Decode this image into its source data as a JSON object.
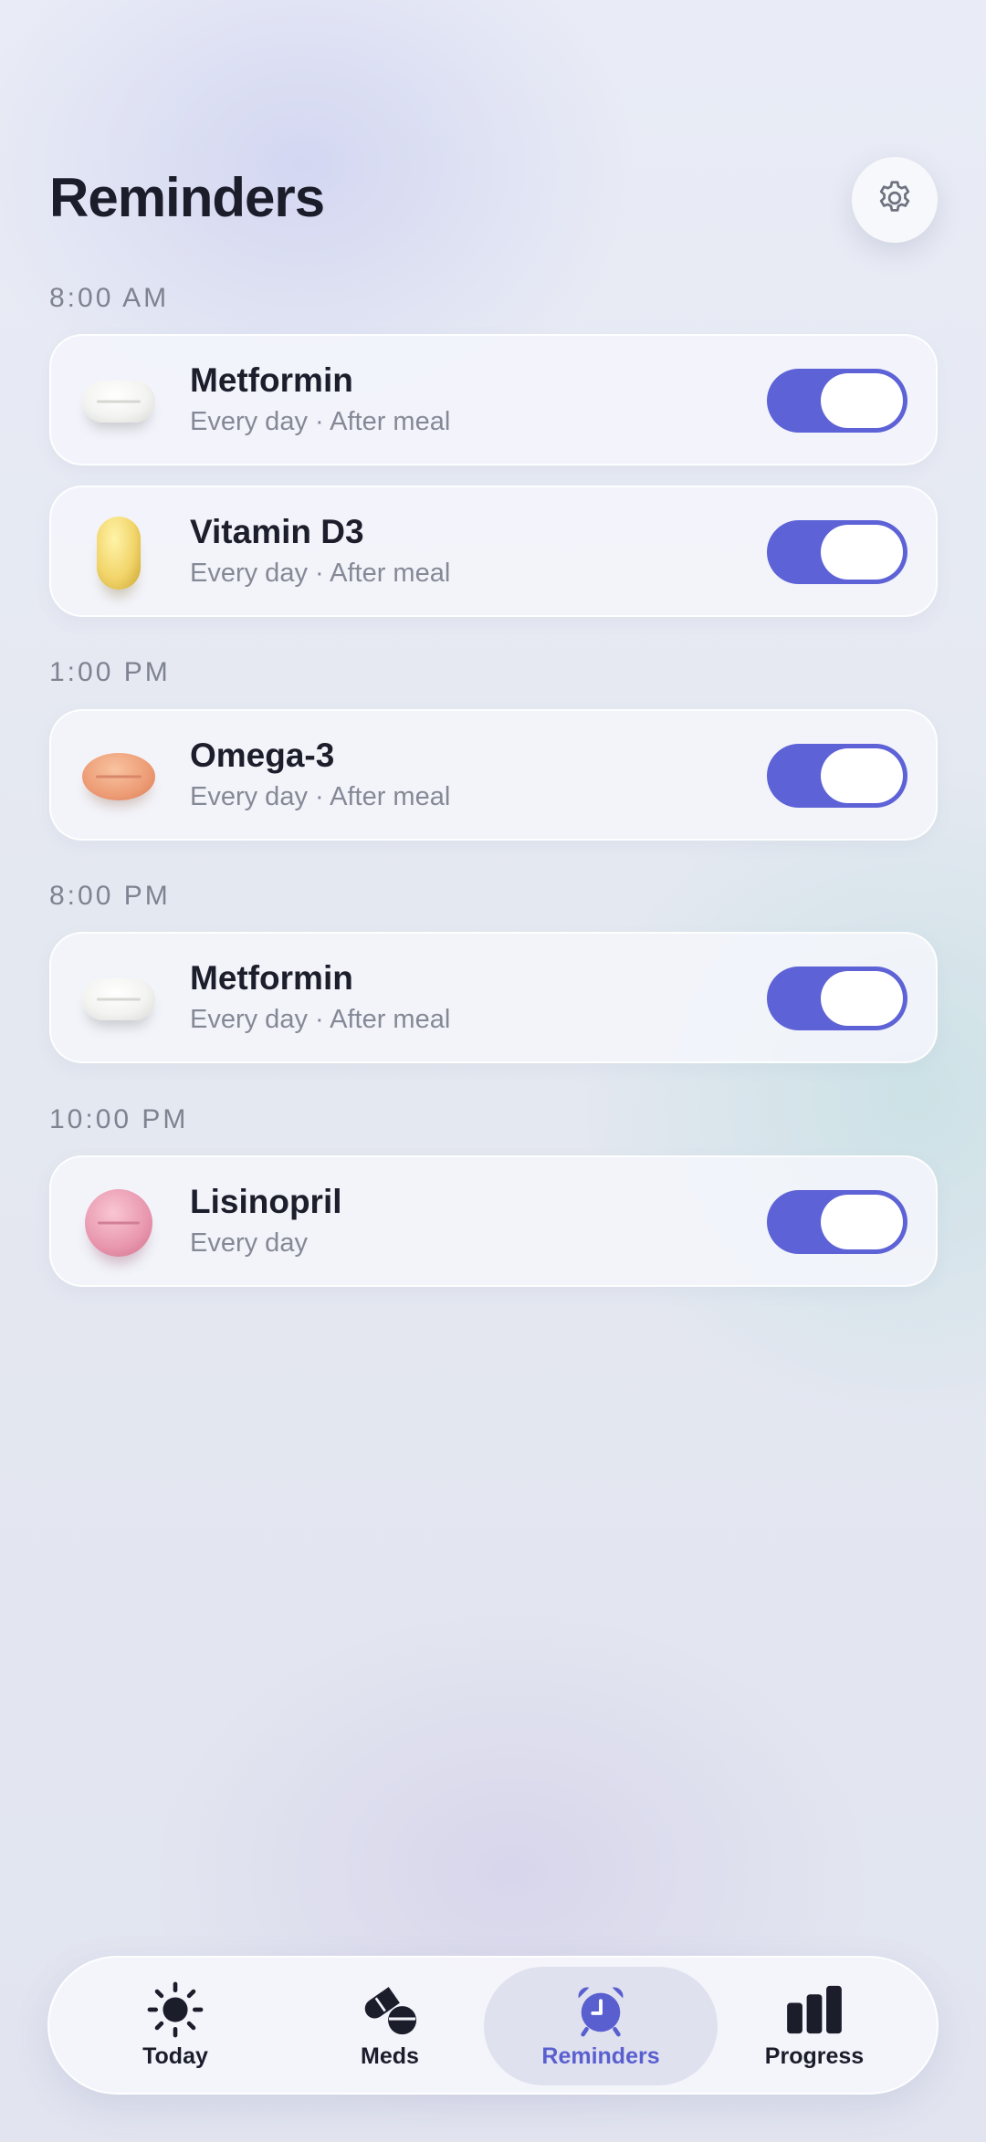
{
  "header": {
    "title": "Reminders",
    "settings_icon": "gear-icon"
  },
  "sections": [
    {
      "time": "8:00 AM"
    },
    {
      "time": "1:00 PM"
    },
    {
      "time": "8:00 PM"
    },
    {
      "time": "10:00 PM"
    }
  ],
  "reminders": [
    {
      "name": "Metformin",
      "schedule": "Every day · After meal",
      "pill": "white-oval-pill-icon",
      "enabled": true
    },
    {
      "name": "Vitamin D3",
      "schedule": "Every day · After meal",
      "pill": "yellow-capsule-icon",
      "enabled": true
    },
    {
      "name": "Omega-3",
      "schedule": "Every day · After meal",
      "pill": "orange-oval-pill-icon",
      "enabled": true
    },
    {
      "name": "Metformin",
      "schedule": "Every day · After meal",
      "pill": "white-oval-pill-icon",
      "enabled": true
    },
    {
      "name": "Lisinopril",
      "schedule": "Every day",
      "pill": "pink-round-pill-icon",
      "enabled": true
    }
  ],
  "tabbar": {
    "tabs": [
      {
        "label": "Today",
        "icon": "sun-icon",
        "active": false
      },
      {
        "label": "Meds",
        "icon": "pills-icon",
        "active": false
      },
      {
        "label": "Reminders",
        "icon": "alarm-clock-icon",
        "active": true
      },
      {
        "label": "Progress",
        "icon": "bar-chart-icon",
        "active": false
      }
    ]
  },
  "colors": {
    "accent": "#5d62d6",
    "active_tab_label": "#5a5fd0",
    "title": "#1b1d2b",
    "secondary_text": "#858996"
  }
}
